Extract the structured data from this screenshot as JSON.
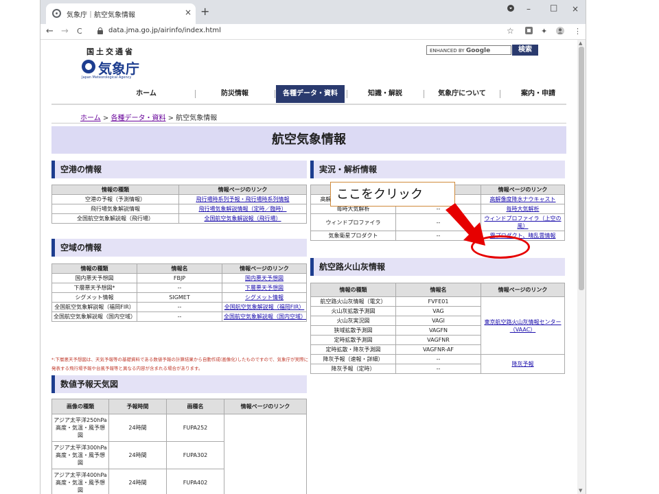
{
  "browser": {
    "tab_title": "気象庁｜航空気象情報",
    "tab_close": "×",
    "new_tab": "+",
    "url": "data.jma.go.jp/airinfo/index.html",
    "win_min": "–",
    "win_max": "□",
    "win_close": "×",
    "back": "←",
    "forward": "→",
    "reload": "C",
    "star": "☆",
    "puzzle": "✦",
    "menu": "⋮"
  },
  "header": {
    "ministry": "国土交通省",
    "agency": "気象庁",
    "agency_en": "Japan Meteorological Agency",
    "search_prefix": "ENHANCED BY",
    "search_brand": "Google",
    "search_button": "検索"
  },
  "global_nav": [
    "ホーム",
    "防災情報",
    "各種データ・資料",
    "知識・解説",
    "気象庁について",
    "案内・申請"
  ],
  "breadcrumb": {
    "home": "ホーム",
    "sep": " > ",
    "data": "各種データ・資料",
    "current": "航空気象情報"
  },
  "page_title": "航空気象情報",
  "airport": {
    "heading": "空港の情報",
    "headers": [
      "情報の種類",
      "情報ページのリンク"
    ],
    "rows": [
      [
        "空港の予報（予測情報）",
        "飛行場時系列予報・飛行場時系列情報"
      ],
      [
        "飛行場気象解説情報",
        "飛行場気象解説情報（定時／臨時）"
      ],
      [
        "全国航空気象解説報（飛行場）",
        "全国航空気象解説報（飛行場）"
      ]
    ]
  },
  "airspace": {
    "heading": "空域の情報",
    "headers": [
      "情報の種類",
      "情報名",
      "情報ページのリンク"
    ],
    "rows": [
      [
        "国内悪天予想図",
        "FBJP",
        "国内悪天予想図"
      ],
      [
        "下層悪天予想図*",
        "--",
        "下層悪天予想図"
      ],
      [
        "シグメット情報",
        "SIGMET",
        "シグメット情報"
      ],
      [
        "全国航空気象解説報（福岡FIR）",
        "--",
        "全国航空気象解説報（福岡FIR）"
      ],
      [
        "全国航空気象解説報（国内空域）",
        "--",
        "全国航空気象解説報（国内空域）"
      ]
    ]
  },
  "note": "*:下層悪天予想図は、天気予報等の基礎資料である数値予報の計算結果から自動作成(画像化)したものですので、気象庁が実際に発表する飛行場予報や台風予報等と異なる内容が含まれる場合があります。",
  "nwp": {
    "heading": "数値予報天気図",
    "headers": [
      "画像の種類",
      "予報時間",
      "画種名",
      "情報ページのリンク"
    ],
    "rows": [
      [
        "アジア太平洋250hPa高度・気温・風予想図",
        "24時間",
        "FUPA252",
        ""
      ],
      [
        "アジア太平洋300hPa高度・気温・風予想図",
        "24時間",
        "FUPA302",
        ""
      ],
      [
        "アジア太平洋400hPa高度・気温・風予想図",
        "24時間",
        "FUPA402",
        ""
      ]
    ]
  },
  "analysis": {
    "heading": "実況・解析情報",
    "headers": [
      "情報の種類",
      "情報名",
      "情報ページのリンク"
    ],
    "rows": [
      [
        "高解像度降水ナウキャスト",
        "--",
        "高解像度降水ナウキャスト"
      ],
      [
        "毎時大気解析",
        "--",
        "毎時大気解析"
      ],
      [
        "ウィンドプロファイラ",
        "--",
        "ウィンドプロファイラ（上空の風）"
      ],
      [
        "気象衛星プロダクト",
        "--",
        "霧プロダクト、晴乱雲情報"
      ]
    ]
  },
  "volcano": {
    "heading": "航空路火山灰情報",
    "headers": [
      "情報の種類",
      "情報名",
      "情報ページのリンク"
    ],
    "rows": [
      [
        "航空路火山灰情報（電文）",
        "FVFE01"
      ],
      [
        "火山灰拡散予測図",
        "VAG"
      ],
      [
        "火山灰実況図",
        "VAGI"
      ],
      [
        "狭域拡散予測図",
        "VAGFN"
      ],
      [
        "定時拡散予測図",
        "VAGFNR"
      ],
      [
        "定時拡散・降灰予測図",
        "VAGFNR-AF"
      ],
      [
        "降灰予報（速報・詳細）",
        "--"
      ],
      [
        "降灰予報（定時）",
        "--"
      ]
    ],
    "link_vaac": "東京航空路火山灰情報センター（VAAC）",
    "link_ash": "降灰予報"
  },
  "annotation": {
    "callout": "ここをクリック",
    "color": "#e60000"
  }
}
